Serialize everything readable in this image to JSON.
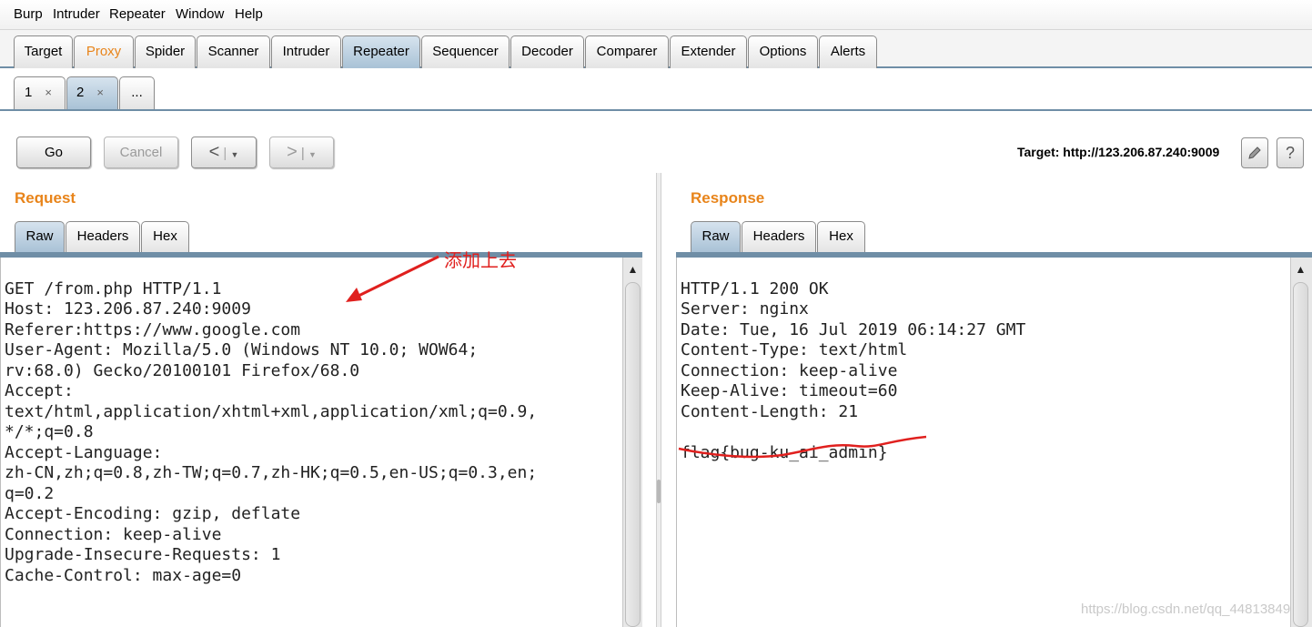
{
  "menubar": {
    "items": [
      "Burp",
      "Intruder",
      "Repeater",
      "Window",
      "Help"
    ]
  },
  "main_tabs": [
    "Target",
    "Proxy",
    "Spider",
    "Scanner",
    "Intruder",
    "Repeater",
    "Sequencer",
    "Decoder",
    "Comparer",
    "Extender",
    "Options",
    "Alerts"
  ],
  "repeater_tabs": [
    {
      "label": "1",
      "close": "×"
    },
    {
      "label": "2",
      "close": "×"
    },
    {
      "label": "..."
    }
  ],
  "toolbar": {
    "go": "Go",
    "cancel": "Cancel",
    "back": "<",
    "forward": ">",
    "dropdown": "▼",
    "target_label": "Target: http://123.206.87.240:9009"
  },
  "request": {
    "title": "Request",
    "tabs": [
      "Raw",
      "Headers",
      "Hex"
    ],
    "lines": [
      "GET /from.php HTTP/1.1",
      "Host: 123.206.87.240:9009",
      "Referer:https://www.google.com",
      "User-Agent: Mozilla/5.0 (Windows NT 10.0; WOW64;",
      "rv:68.0) Gecko/20100101 Firefox/68.0",
      "Accept:",
      "text/html,application/xhtml+xml,application/xml;q=0.9,",
      "*/*;q=0.8",
      "Accept-Language:",
      "zh-CN,zh;q=0.8,zh-TW;q=0.7,zh-HK;q=0.5,en-US;q=0.3,en;",
      "q=0.2",
      "Accept-Encoding: gzip, deflate",
      "Connection: keep-alive",
      "Upgrade-Insecure-Requests: 1",
      "Cache-Control: max-age=0"
    ]
  },
  "response": {
    "title": "Response",
    "tabs": [
      "Raw",
      "Headers",
      "Hex"
    ],
    "lines": [
      "HTTP/1.1 200 OK",
      "Server: nginx",
      "Date: Tue, 16 Jul 2019 06:14:27 GMT",
      "Content-Type: text/html",
      "Connection: keep-alive",
      "Keep-Alive: timeout=60",
      "Content-Length: 21"
    ],
    "flag": "flag{bug-ku_ai_admin}"
  },
  "annotation": {
    "text": "添加上去",
    "color": "#e0201e"
  },
  "watermark": "https://blog.csdn.net/qq_44813849",
  "colors": {
    "accent_orange": "#e8841a",
    "tab_active": "#a9c2d6",
    "separator": "#6f8ea6",
    "annotation_red": "#e0201e"
  }
}
